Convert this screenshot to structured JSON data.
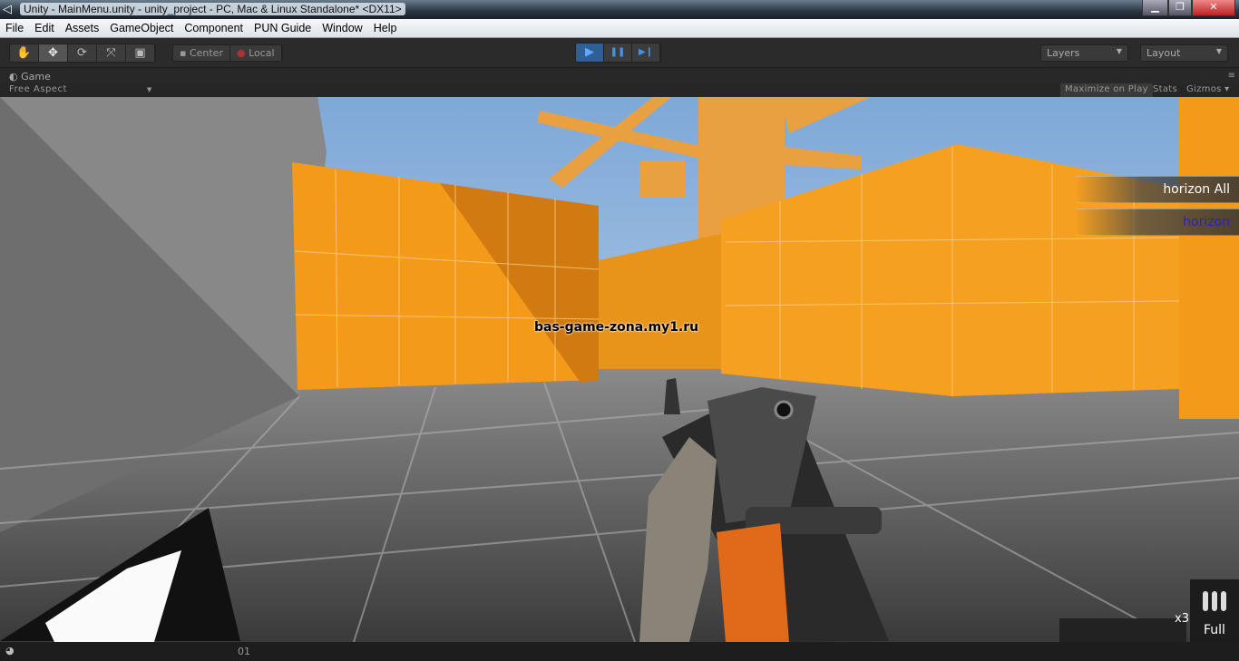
{
  "window": {
    "title": "Unity - MainMenu.unity - unity_project - PC, Mac & Linux Standalone* <DX11>",
    "controls": [
      "minimize",
      "restore",
      "close"
    ]
  },
  "menu": [
    "File",
    "Edit",
    "Assets",
    "GameObject",
    "Component",
    "PUN Guide",
    "Window",
    "Help"
  ],
  "toolbar": {
    "tools": [
      {
        "icon": "hand-icon",
        "glyph": "✋"
      },
      {
        "icon": "move-icon",
        "glyph": "✥"
      },
      {
        "icon": "rotate-icon",
        "glyph": "⟳"
      },
      {
        "icon": "scale-icon",
        "glyph": "⤧"
      },
      {
        "icon": "rect-icon",
        "glyph": "▣"
      }
    ],
    "pivot": "Center",
    "space": "Local",
    "play": {
      "glyph": "▶",
      "pause": "❚❚",
      "step": "▶❙"
    },
    "layers": "Layers",
    "layout": "Layout"
  },
  "game": {
    "tab": "Game",
    "aspect": "Free Aspect",
    "maximize": "Maximize on Play",
    "stats": "Stats",
    "gizmos": "Gizmos"
  },
  "hud": {
    "watermark": "bas-game-zona.my1.ru",
    "player_row": "horizon  All",
    "player_name": "horizon",
    "player_name_color": "#2a1fd0",
    "ammo_multiplier": "x3",
    "ammo_status": "Full"
  },
  "status": {
    "text": "01"
  },
  "colors": {
    "wall": "#f39a1a",
    "sky": "#8fb6df",
    "floor": "#5c5c5c"
  }
}
